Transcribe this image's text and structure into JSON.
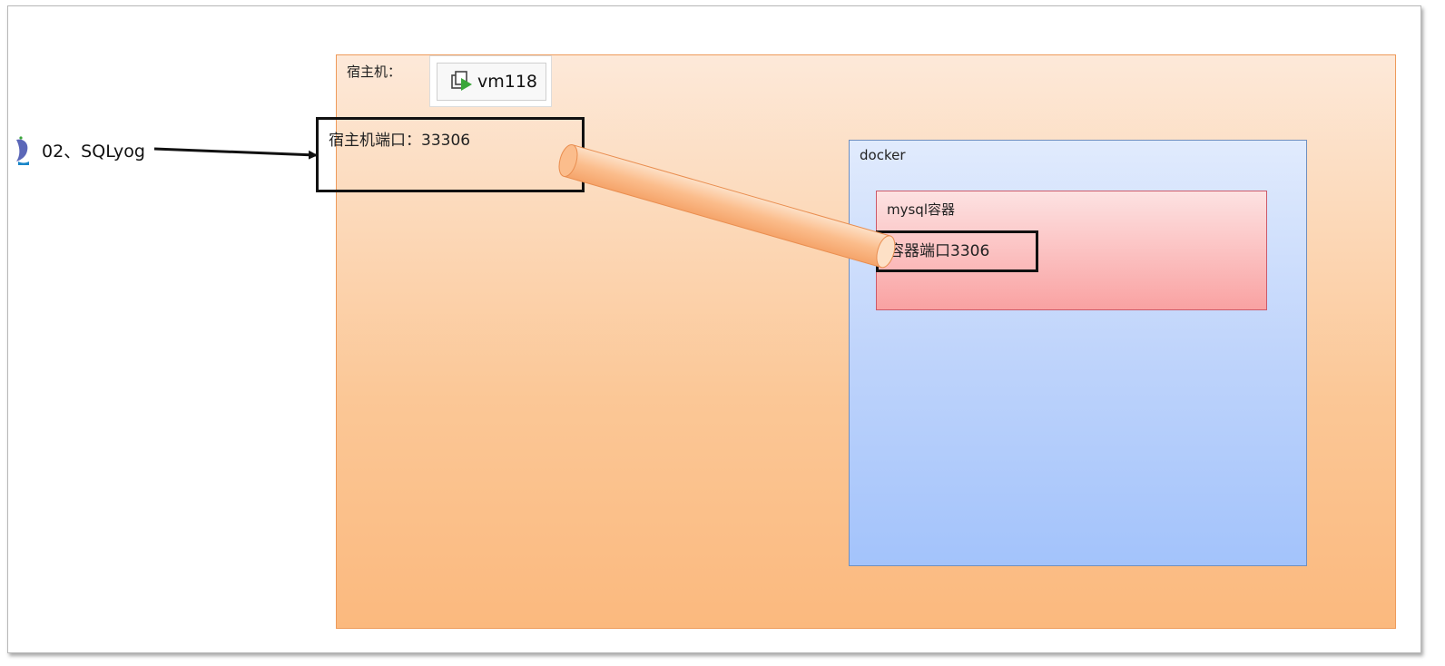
{
  "host": {
    "label": "宿主机：",
    "port_label": "宿主机端口：33306"
  },
  "vm": {
    "name": "vm118",
    "icon": "vmware-vm-icon"
  },
  "client": {
    "label": "02、SQLyog",
    "icon": "sqlyog-dolphin-icon"
  },
  "docker": {
    "label": "docker"
  },
  "container": {
    "label": "mysql容器",
    "port_label": "容器端口3306"
  },
  "colors": {
    "host_fill": "#fbc796",
    "docker_fill": "#bfd4fb",
    "container_fill": "#fbbcbc",
    "pipe": "#f9b27a"
  }
}
